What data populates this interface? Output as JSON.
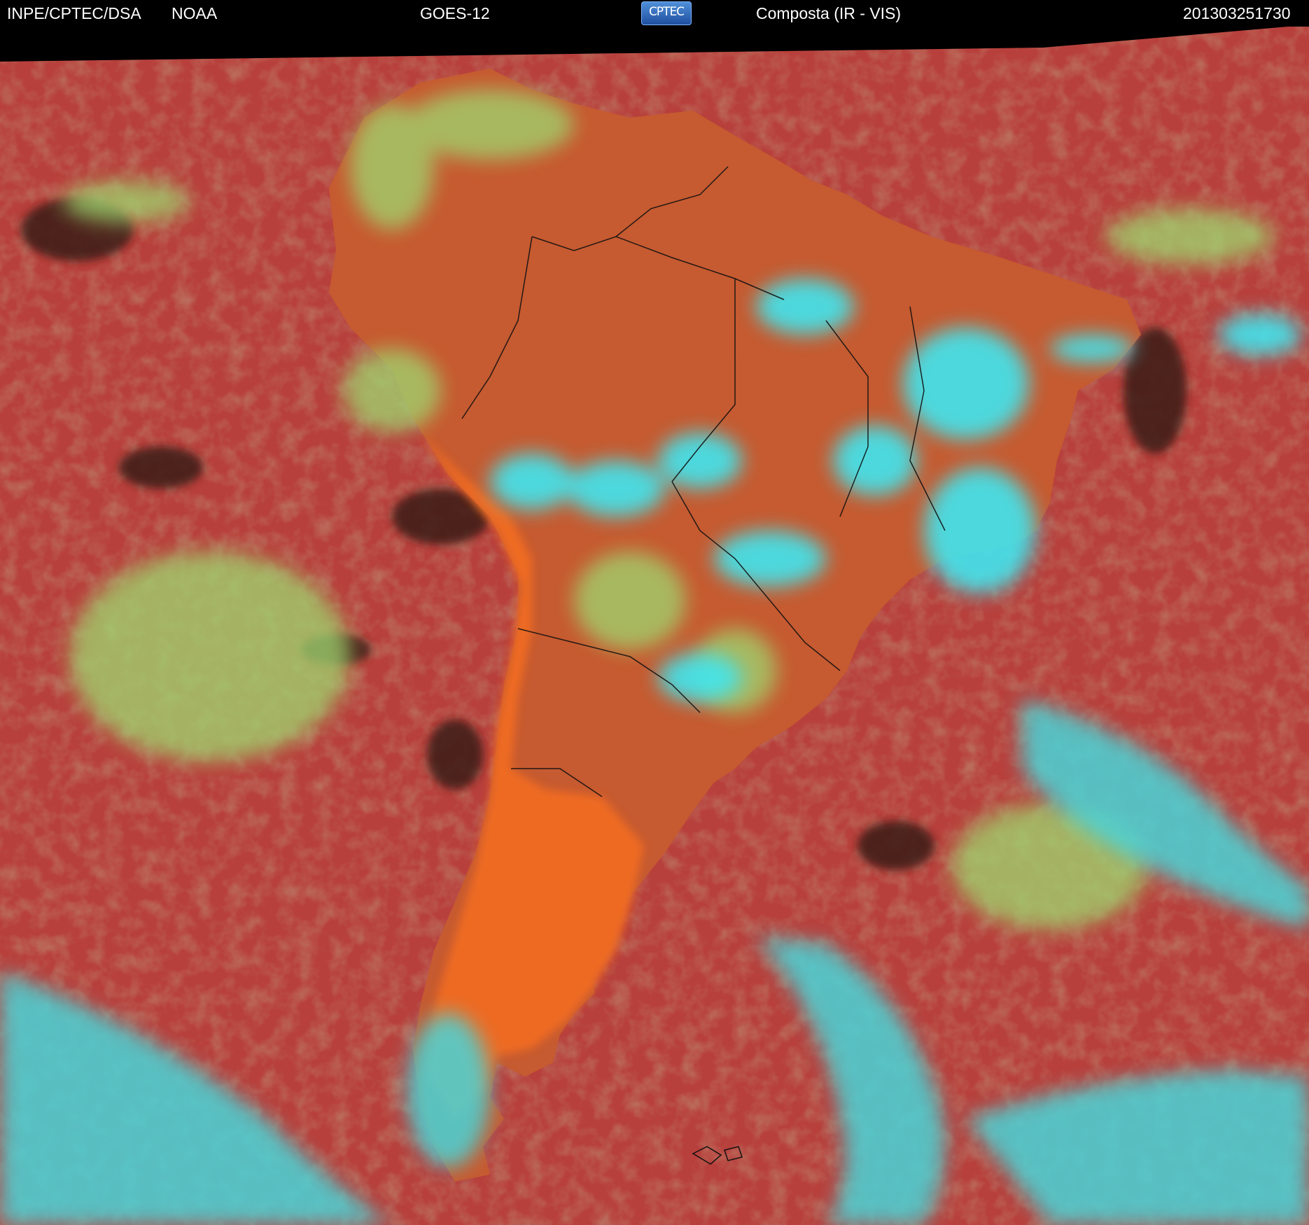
{
  "header": {
    "institution": "INPE/CPTEC/DSA",
    "agency": "NOAA",
    "satellite": "GOES-12",
    "logo_text": "CPTEC",
    "product": "Composta (IR - VIS)",
    "timestamp": "201303251730"
  },
  "colors": {
    "ocean": "#b8403c",
    "land": "#c85a2e",
    "andes_desert": "#f06a1e",
    "cloud_cyan": "#39e8f0",
    "cloud_green": "#8fd87a",
    "borders": "#111111"
  },
  "map": {
    "region": "South America",
    "logo_icon": "cptec-logo"
  }
}
